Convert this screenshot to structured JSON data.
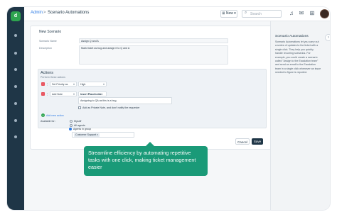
{
  "colors": {
    "sidebar": "#1f3647",
    "accent": "#2ea44f",
    "primary": "#1f3647",
    "tooltip": "#1a9a78"
  },
  "topbar": {
    "breadcrumb_root": "Admin",
    "breadcrumb_separator": ">",
    "breadcrumb_current": "Scenario Automations",
    "new_label": "New",
    "search_placeholder": "Search"
  },
  "form": {
    "title": "New Scenario",
    "name_label": "Scenario Name",
    "name_value": "Assign Q and A",
    "description_label": "Description",
    "description_value": "Mark ticket as bug and assign it to Q and A"
  },
  "actions": {
    "heading": "Actions",
    "subheading": "Perform these actions",
    "rows": [
      {
        "action": "Set Priority as",
        "value": "High"
      },
      {
        "action": "Add Note",
        "value": "Insert Placeholder",
        "note_text": "Assigning to QA as this is a bug.",
        "private_note": "Add as Private Note, and don't notify the requester"
      }
    ],
    "add_new": "Add new action"
  },
  "availability": {
    "label": "Available for :",
    "options": [
      "Myself",
      "All agents",
      "Agents in group"
    ],
    "selected_index": 2,
    "group_tag": "Customer Support"
  },
  "buttons": {
    "cancel": "Cancel",
    "save": "Save"
  },
  "help": {
    "title": "Scenario Automations",
    "body": [
      "Scenario Automations let you carry out",
      "a series of updates to the ticket with a",
      "single click. They help you quickly",
      "handle recurring scenarios. For",
      "example, you could create a scenario",
      "called \"Assign to the Escalation team\"",
      "and send an email to the Escalation",
      "team in a single click whenever an issue",
      "needed to figure is reported."
    ]
  },
  "tooltip": {
    "text": "Streamline efficiency by automating repetitive tasks with one click, making ticket management easier"
  }
}
